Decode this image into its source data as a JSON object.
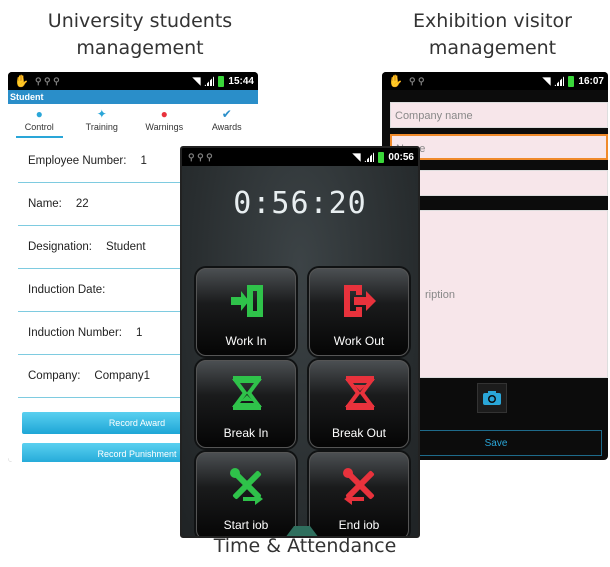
{
  "captions": {
    "left": "University students management",
    "right": "Exhibition visitor management",
    "bottom": "Time & Attendance"
  },
  "left_phone": {
    "status_time": "15:44",
    "app_title": "Student",
    "tabs": [
      {
        "label": "Control",
        "icon": "person-icon"
      },
      {
        "label": "Training",
        "icon": "training-icon"
      },
      {
        "label": "Warnings",
        "icon": "warning-icon"
      },
      {
        "label": "Awards",
        "icon": "check-icon"
      }
    ],
    "fields": [
      {
        "label": "Employee Number:",
        "value": "1"
      },
      {
        "label": "Name:",
        "value": "22"
      },
      {
        "label": "Designation:",
        "value": "Student"
      },
      {
        "label": "Induction Date:",
        "value": ""
      },
      {
        "label": "Induction Number:",
        "value": "1"
      },
      {
        "label": "Company:",
        "value": "Company1"
      }
    ],
    "buttons": {
      "record_award": "Record Award",
      "record_punishment": "Record Punishment"
    }
  },
  "right_phone": {
    "status_time": "16:07",
    "placeholders": {
      "company": "Company name",
      "name": "Name",
      "description": "ription"
    },
    "save_label": "Save"
  },
  "center_phone": {
    "status_time": "00:56",
    "timer": "0:56:20",
    "buttons": {
      "work_in": "Work In",
      "work_out": "Work Out",
      "break_in": "Break In",
      "break_out": "Break Out",
      "start_job": "Start iob",
      "end_job": "End iob"
    }
  },
  "colors": {
    "accent_blue": "#2aa6d8",
    "green": "#2fc24a",
    "red": "#e8323c"
  }
}
